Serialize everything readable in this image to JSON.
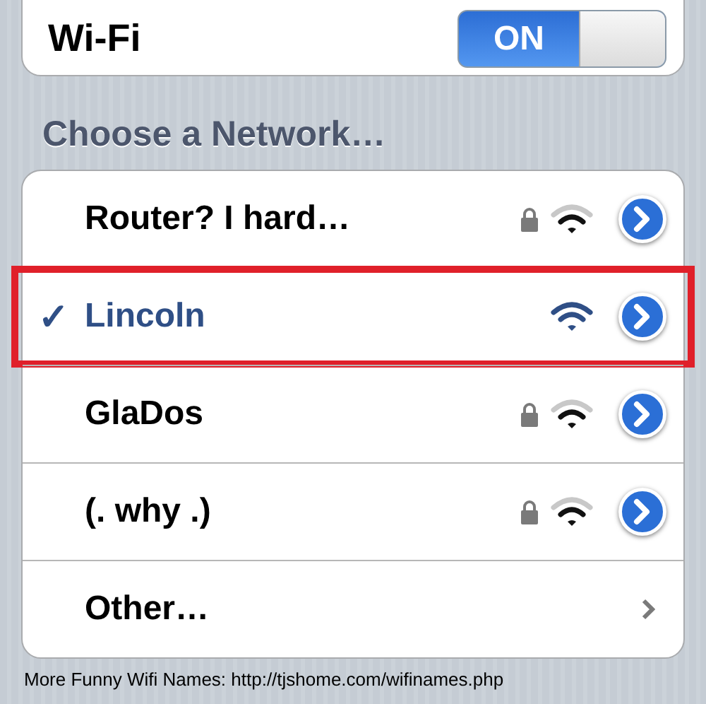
{
  "wifi": {
    "label": "Wi-Fi",
    "on": true,
    "switch_text": "ON"
  },
  "section_header": "Choose a Network…",
  "networks": [
    {
      "kind": "network",
      "name": "Router? I hard…",
      "selected": false,
      "secured": true,
      "highlighted": false
    },
    {
      "kind": "network",
      "name": "Lincoln",
      "selected": true,
      "secured": false,
      "highlighted": true,
      "check": "✓"
    },
    {
      "kind": "network",
      "name": "GlaDos",
      "selected": false,
      "secured": true,
      "highlighted": false
    },
    {
      "kind": "network",
      "name": "(. why .)",
      "selected": false,
      "secured": true,
      "highlighted": false
    },
    {
      "kind": "other",
      "name": "Other…"
    }
  ],
  "caption": "More Funny Wifi Names: http://tjshome.com/wifinames.php"
}
